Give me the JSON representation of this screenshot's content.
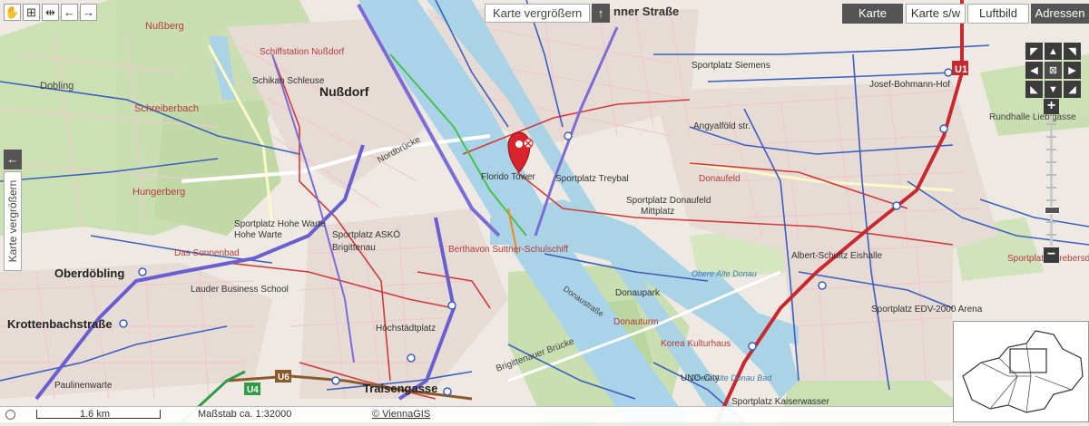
{
  "toolbar": {
    "pan_glyph": "✋",
    "zoombox_glyph": "⊞",
    "measure_glyph": "⇹",
    "back_glyph": "←",
    "forward_glyph": "→",
    "expand_top_label": "Karte vergrößern",
    "expand_top_arrow": "↑",
    "expand_left_label": "Karte vergrößern",
    "expand_left_arrow": "←"
  },
  "layer_tabs": [
    {
      "label": "Karte",
      "active": true
    },
    {
      "label": "Karte s/w",
      "active": false
    },
    {
      "label": "Luftbild",
      "active": false
    },
    {
      "label": "Adressen",
      "active": true
    }
  ],
  "nav": {
    "pan_nw": "◤",
    "pan_n": "▲",
    "pan_ne": "◥",
    "pan_w": "◀",
    "pan_center": "⊠",
    "pan_e": "▶",
    "pan_sw": "◣",
    "pan_s": "▼",
    "pan_se": "◢",
    "zoom_in": "+",
    "zoom_out": "−"
  },
  "status": {
    "scale_label": "1.6 km",
    "scale_text": "Maßstab ca. 1:32000",
    "copyright": "© ViennaGIS"
  },
  "map_labels": {
    "districts": [
      "Nußdorf",
      "Oberdöbling",
      "Krottenbachstraße",
      "Traisengasse",
      "Nußberg",
      "Dobling",
      "Schreiberbach",
      "Hungerberg",
      "Rundhalle Liebigasse"
    ],
    "pois": [
      "Sportplatz Siemens",
      "Josef-Bohmann-Hof",
      "Angyalföld str.",
      "Florido Tower",
      "Sportplatz Treybal",
      "Sportplatz Donaufeld",
      "Mittplatz",
      "Berthavon Suttner-Schulschiff",
      "Sportplatz Hohe Warte",
      "Sportplatz ASKÖ",
      "Lauder Business School",
      "Donaupark",
      "Donauturm",
      "Korea Kulturhaus",
      "Obere Alte Donau",
      "Albert-Schultz Eishalle",
      "Sportplatz EDV-2000 Arena",
      "Obere Alte Donau Bad",
      "Sportplatz Kaiserwasser",
      "UNO-City",
      "Donaufeld",
      "Brigittenauer Brücke",
      "Nordbrücke",
      "Schiffstation Nußdorf",
      "Schikan Schleuse",
      "Paulinenwarte",
      "Höchstädtplatz",
      "Sportplatz Strebersdorf",
      "Das Sonnenbad",
      "Hohe Warte",
      "Brigittenau",
      "Donaustraße"
    ],
    "street_top": "nner Straße",
    "line_badges": [
      "U1",
      "U6",
      "U4"
    ]
  }
}
